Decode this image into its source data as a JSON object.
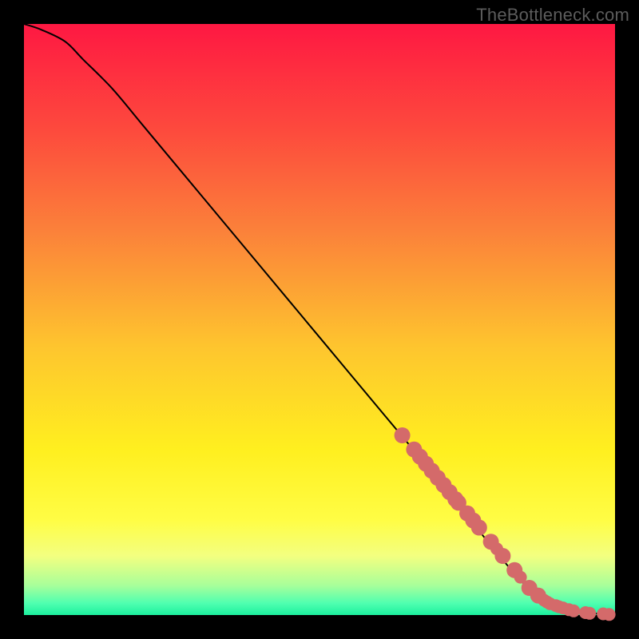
{
  "watermark": {
    "text": "TheBottleneck.com"
  },
  "colors": {
    "curve": "#000000",
    "point_fill": "#d46a6a",
    "point_stroke": "#b85252",
    "gradient_stops": [
      {
        "pct": 0,
        "hex": "#fe1842"
      },
      {
        "pct": 18,
        "hex": "#fd4a3d"
      },
      {
        "pct": 35,
        "hex": "#fb813a"
      },
      {
        "pct": 55,
        "hex": "#fec62e"
      },
      {
        "pct": 72,
        "hex": "#ffef1f"
      },
      {
        "pct": 84,
        "hex": "#fffd45"
      },
      {
        "pct": 90,
        "hex": "#f3ff80"
      },
      {
        "pct": 95,
        "hex": "#a8ff9a"
      },
      {
        "pct": 98,
        "hex": "#4fffb0"
      },
      {
        "pct": 100,
        "hex": "#1cf09e"
      }
    ]
  },
  "chart_data": {
    "type": "line",
    "title": "",
    "xlabel": "",
    "ylabel": "",
    "xlim": [
      0,
      100
    ],
    "ylim": [
      0,
      100
    ],
    "series": [
      {
        "name": "curve",
        "x": [
          0,
          3,
          7,
          10,
          15,
          20,
          30,
          40,
          50,
          60,
          70,
          78,
          83,
          86,
          88,
          90,
          92,
          94,
          96,
          98,
          100
        ],
        "y": [
          100,
          99,
          97,
          94,
          89,
          83,
          71,
          59,
          47,
          35,
          23,
          13,
          7,
          4,
          2.5,
          1.6,
          0.9,
          0.5,
          0.3,
          0.15,
          0.1
        ]
      }
    ],
    "scatter_points": {
      "name": "markers",
      "x": [
        64,
        66,
        67,
        68,
        69,
        70,
        71,
        72,
        73,
        73.5,
        75,
        76,
        77,
        79,
        80,
        81,
        83,
        84,
        85.5,
        87,
        88,
        88.5,
        89,
        90,
        90.5,
        91.2,
        92.2,
        93,
        95,
        95.7,
        98,
        99
      ],
      "y": [
        30.4,
        28.0,
        26.8,
        25.6,
        24.4,
        23.2,
        22.0,
        20.8,
        19.6,
        19.0,
        17.2,
        16.0,
        14.8,
        12.4,
        11.2,
        10.0,
        7.6,
        6.4,
        4.6,
        3.3,
        2.5,
        2.2,
        1.9,
        1.6,
        1.4,
        1.2,
        0.9,
        0.7,
        0.4,
        0.3,
        0.2,
        0.1
      ],
      "r": [
        10,
        10,
        10,
        10,
        10,
        10,
        10,
        10,
        10,
        10,
        10,
        10,
        10,
        10,
        8,
        10,
        10,
        8,
        10,
        10,
        8,
        8,
        8,
        8,
        8,
        8,
        8,
        8,
        8,
        8,
        8,
        8
      ]
    }
  }
}
